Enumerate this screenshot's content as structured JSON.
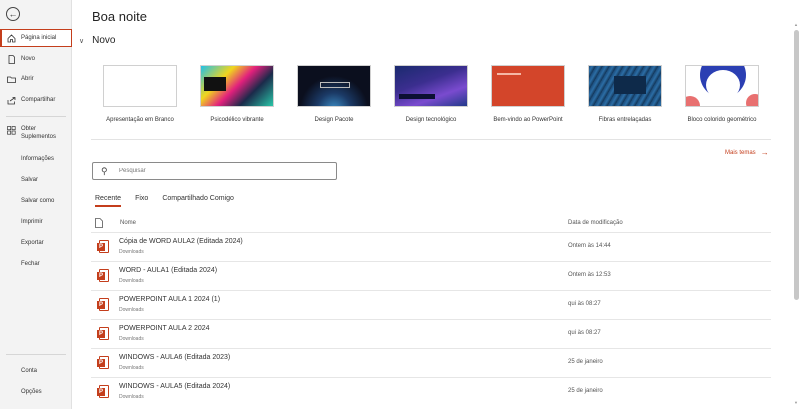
{
  "sidebar": {
    "items": [
      {
        "label": "Página inicial",
        "icon": "home-icon"
      },
      {
        "label": "Novo",
        "icon": "new-file-icon"
      },
      {
        "label": "Abrir",
        "icon": "folder-icon"
      },
      {
        "label": "Compartilhar",
        "icon": "share-icon"
      },
      {
        "label": "Obter Suplementos",
        "icon": "store-icon"
      },
      {
        "label": "Informações"
      },
      {
        "label": "Salvar"
      },
      {
        "label": "Salvar como"
      },
      {
        "label": "Imprimir"
      },
      {
        "label": "Exportar"
      },
      {
        "label": "Fechar"
      }
    ],
    "bottom": [
      {
        "label": "Conta"
      },
      {
        "label": "Opções"
      }
    ]
  },
  "main": {
    "greeting": "Boa noite",
    "new_section": "Novo",
    "templates": [
      {
        "label": "Apresentação em Branco"
      },
      {
        "label": "Psicodélico vibrante"
      },
      {
        "label": "Design Pacote"
      },
      {
        "label": "Design tecnológico"
      },
      {
        "label": "Bem-vindo ao PowerPoint"
      },
      {
        "label": "Fibras entrelaçadas"
      },
      {
        "label": "Bloco colorido geométrico"
      }
    ],
    "more_themes": "Mais temas",
    "search_placeholder": "Pesquisar",
    "tabs": [
      "Recente",
      "Fixo",
      "Compartilhado Comigo"
    ],
    "columns": {
      "name": "Nome",
      "date": "Data de modificação"
    },
    "files": [
      {
        "name": "Cópia de WORD AULA2 (Editada 2024)",
        "location": "Downloads",
        "date": "Ontem às 14:44"
      },
      {
        "name": "WORD - AULA1 (Editada 2024)",
        "location": "Downloads",
        "date": "Ontem às 12:53"
      },
      {
        "name": "POWERPOINT AULA 1 2024 (1)",
        "location": "Downloads",
        "date": "qui às 08:27"
      },
      {
        "name": "POWERPOINT AULA 2 2024",
        "location": "Downloads",
        "date": "qui às 08:27"
      },
      {
        "name": "WINDOWS - AULA6 (Editada 2023)",
        "location": "Downloads",
        "date": "25 de janeiro"
      },
      {
        "name": "WINDOWS - AULA5 (Editada 2024)",
        "location": "Downloads",
        "date": "25 de janeiro"
      }
    ]
  },
  "colors": {
    "accent": "#c43e1c"
  }
}
